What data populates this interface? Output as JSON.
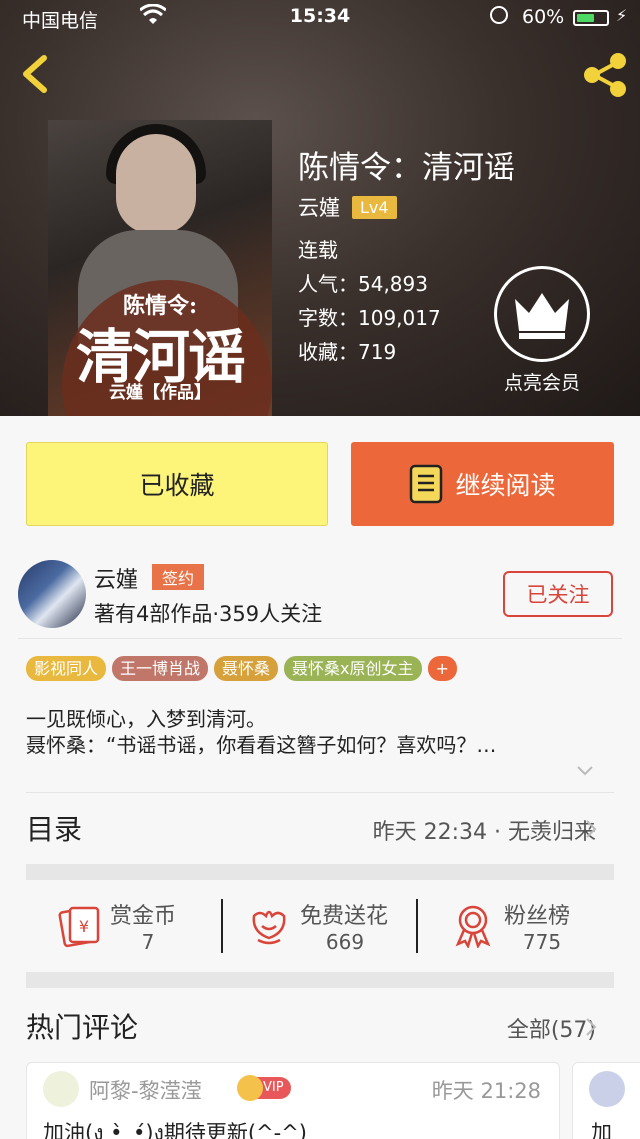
{
  "status_bar": {
    "carrier": "中国电信",
    "time": "15:34",
    "battery": "60%",
    "battery_level": 0.6
  },
  "book": {
    "title": "陈情令：清河谣",
    "author": "云嫤",
    "level": "Lv4",
    "status": "连载",
    "popularity": "人气：54,893",
    "word_count": "字数：109,017",
    "favorites": "收藏：719",
    "cover": {
      "subtitle": "陈情令:",
      "title": "清河谣",
      "author": "云嫤【作品】"
    }
  },
  "vip": {
    "label": "点亮会员"
  },
  "actions": {
    "collect_label": "已收藏",
    "read_label": "继续阅读"
  },
  "author_card": {
    "name": "云嫤",
    "badge": "签约",
    "stats": "著有4部作品·359人关注",
    "follow_label": "已关注"
  },
  "tags": [
    {
      "label": "影视同人",
      "color": "#e8b93e"
    },
    {
      "label": "王一博肖战",
      "color": "#c0776a"
    },
    {
      "label": "聂怀桑",
      "color": "#d6a13a"
    },
    {
      "label": "聂怀桑x原创女主",
      "color": "#9ab455"
    },
    {
      "label": "+",
      "color": "#ec683a"
    }
  ],
  "description": {
    "line1": "一见既倾心，入梦到清河。",
    "line2": "聂怀桑：“书谣书谣，你看看这簪子如何？喜欢吗？…"
  },
  "toc": {
    "label": "目录",
    "latest": "昨天 22:34 · 无羡归来"
  },
  "stats": {
    "reward": {
      "label": "赏金币",
      "value": "7"
    },
    "flowers": {
      "label": "免费送花",
      "value": "669"
    },
    "fans": {
      "label": "粉丝榜",
      "value": "775"
    }
  },
  "comments": {
    "label": "热门评论",
    "all": "全部(57)",
    "items": [
      {
        "user": "阿黎-黎滢滢",
        "vip": "VIP",
        "time": "昨天 21:28",
        "text": "加油(ง •̀_•́)ง期待更新(^-^)"
      },
      {
        "text": "加"
      }
    ]
  },
  "colors": {
    "accent_orange": "#ec683a",
    "collect_yellow": "#fdf47a",
    "follow_red": "#d8453a",
    "icon_yellow": "#f1d23a"
  }
}
